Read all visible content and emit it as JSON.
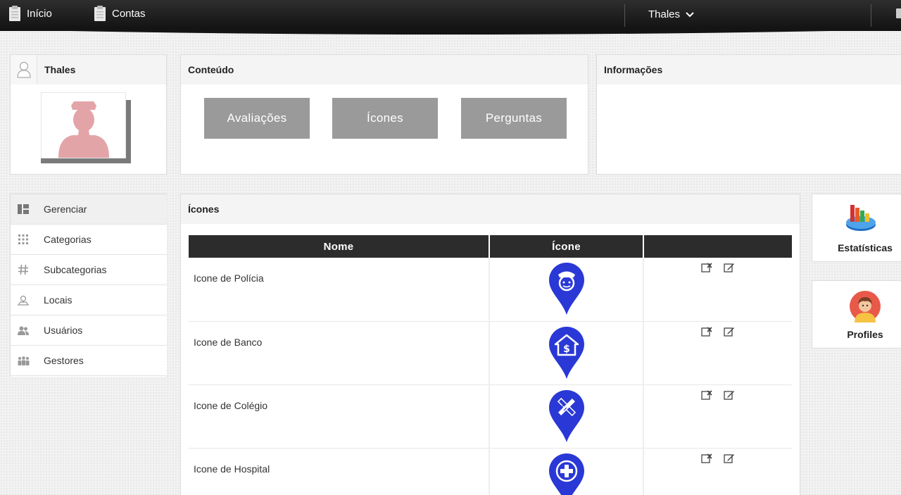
{
  "topbar": {
    "nav": [
      {
        "label": "Início",
        "icon": "clipboard-icon"
      },
      {
        "label": "Contas",
        "icon": "clipboard-icon"
      }
    ],
    "user_name": "Thales",
    "colors": {
      "bar": "#1a1a1a"
    }
  },
  "profile": {
    "title": "Thales",
    "avatar_icon": "user-icon"
  },
  "content": {
    "title": "Conteúdo",
    "buttons": [
      "Avaliações",
      "Ícones",
      "Perguntas"
    ]
  },
  "info": {
    "title": "Informações"
  },
  "sidebar": {
    "items": [
      {
        "label": "Gerenciar",
        "icon": "dashboard-icon"
      },
      {
        "label": "Categorias",
        "icon": "grid-icon"
      },
      {
        "label": "Subcategorias",
        "icon": "hash-icon"
      },
      {
        "label": "Locais",
        "icon": "location-icon"
      },
      {
        "label": "Usuários",
        "icon": "users-icon"
      },
      {
        "label": "Gestores",
        "icon": "group-icon"
      }
    ]
  },
  "icons_panel": {
    "title": "Ícones",
    "columns": [
      "Nome",
      "Ícone",
      ""
    ],
    "rows": [
      {
        "name": "Icone de Polícia",
        "icon": "police-marker-icon"
      },
      {
        "name": "Icone de Banco",
        "icon": "bank-marker-icon"
      },
      {
        "name": "Icone de Colégio",
        "icon": "school-marker-icon"
      },
      {
        "name": "Icone de Hospital",
        "icon": "hospital-marker-icon"
      }
    ],
    "marker_color": "#2a38d6"
  },
  "tiles": [
    {
      "label": "Estatísticas",
      "icon": "statistics-icon"
    },
    {
      "label": "Profiles",
      "icon": "profile-avatar-icon"
    }
  ]
}
